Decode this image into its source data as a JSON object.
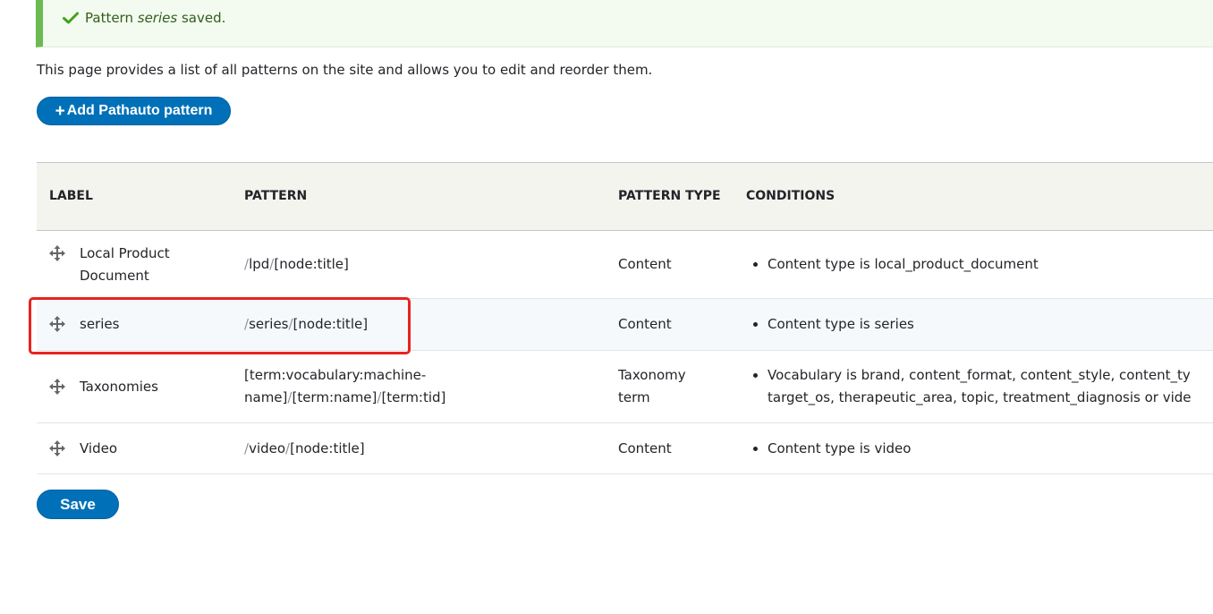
{
  "status_message": {
    "prefix": "Pattern",
    "item": "series",
    "suffix": "saved.",
    "color": "#6bba52"
  },
  "description": "This page provides a list of all patterns on the site and allows you to edit and reorder them.",
  "add_button": {
    "plus": "+",
    "label": "Add Pathauto pattern"
  },
  "table": {
    "headers": {
      "label": "LABEL",
      "pattern": "PATTERN",
      "pattern_type": "PATTERN TYPE",
      "conditions": "CONDITIONS"
    },
    "rows": [
      {
        "label": "Local Product Document",
        "pattern_parts": [
          "/",
          "lpd",
          "/",
          "[node:title]"
        ],
        "type": "Content",
        "condition": "Content type is local_product_document"
      },
      {
        "label": "series",
        "pattern_parts": [
          "/",
          "series",
          "/",
          "[node:title]"
        ],
        "type": "Content",
        "condition": "Content type is series"
      },
      {
        "label": "Taxonomies",
        "pattern_parts": [
          "[term:vocabulary:machine-name]",
          "/",
          "[term:name]",
          "/",
          "[term:tid]"
        ],
        "type": "Taxonomy term",
        "condition_line1": "Vocabulary is brand, content_format, content_style, content_ty",
        "condition_line2": "target_os, therapeutic_area, topic, treatment_diagnosis or vide"
      },
      {
        "label": "Video",
        "pattern_parts": [
          "/",
          "video",
          "/",
          "[node:title]"
        ],
        "type": "Content",
        "condition": "Content type is video"
      }
    ]
  },
  "save_button": {
    "label": "Save"
  },
  "colors": {
    "primary": "#0071b8",
    "highlight": "#e8231f",
    "success": "#6bba52"
  }
}
